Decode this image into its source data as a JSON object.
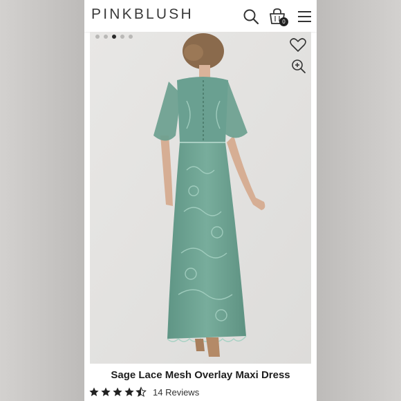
{
  "brand": {
    "logo_text": "PINKBLUSH"
  },
  "header": {
    "icons": [
      "search-icon",
      "shopping-bag-icon",
      "menu-icon"
    ],
    "cart_count": "0"
  },
  "gallery": {
    "image_count": 5,
    "active_index": 2,
    "actions": [
      "heart-icon",
      "zoom-in-icon"
    ]
  },
  "product": {
    "name": "Sage Lace Mesh Overlay Maxi Dress",
    "rating": 4.5,
    "reviews_label": "14 Reviews",
    "dress_color": "#6fa595"
  },
  "colors": {
    "background": "#c9c7c5",
    "text": "#1e1e1e",
    "badge": "#222222"
  }
}
